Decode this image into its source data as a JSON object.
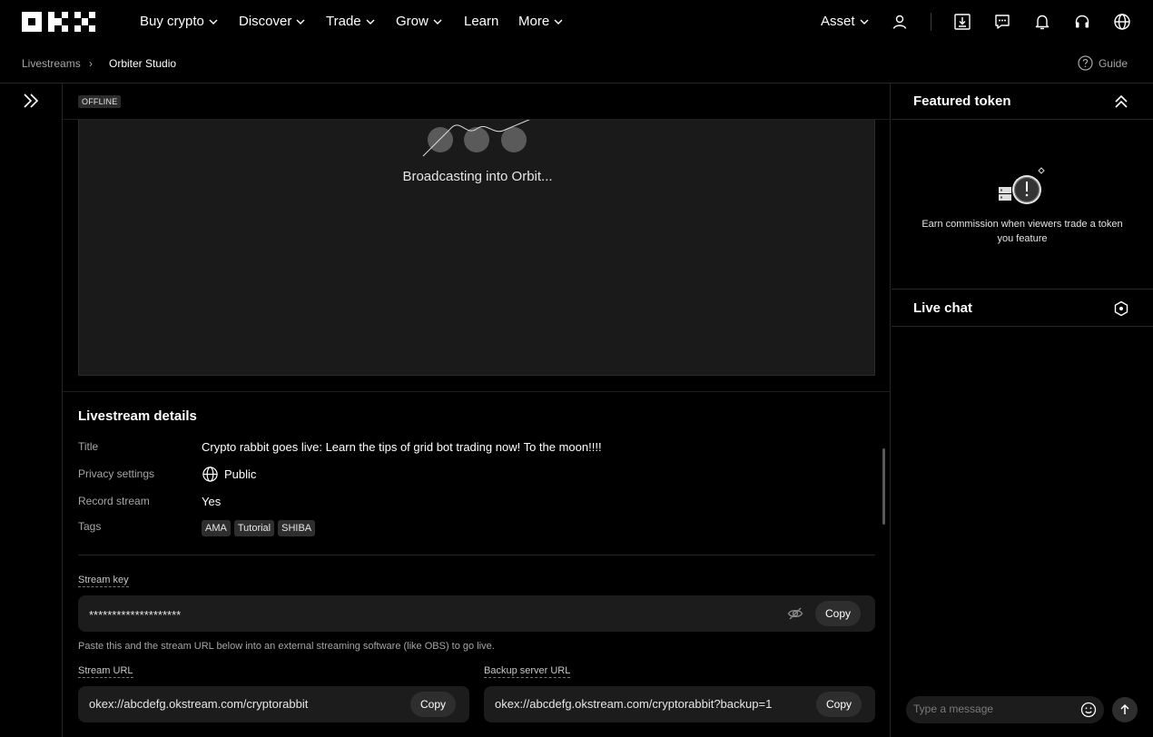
{
  "nav": {
    "logo": "OKX",
    "items": [
      {
        "label": "Buy crypto",
        "dropdown": true
      },
      {
        "label": "Discover",
        "dropdown": true
      },
      {
        "label": "Trade",
        "dropdown": true
      },
      {
        "label": "Grow",
        "dropdown": true
      },
      {
        "label": "Learn",
        "dropdown": false
      },
      {
        "label": "More",
        "dropdown": true
      }
    ],
    "asset_label": "Asset",
    "icons": [
      "user-icon",
      "download-icon",
      "message-icon",
      "bell-icon",
      "headset-icon",
      "globe-icon"
    ]
  },
  "breadcrumb": {
    "parent": "Livestreams",
    "separator": "›",
    "current": "Orbiter Studio"
  },
  "guide_label": "Guide",
  "stream": {
    "status": "OFFLINE",
    "broadcast_text": "Broadcasting into Orbit..."
  },
  "details": {
    "title": "Livestream details",
    "rows": {
      "title_label": "Title",
      "title_value": "Crypto rabbit goes live: Learn the tips of grid bot trading now! To the moon!!!!",
      "privacy_label": "Privacy settings",
      "privacy_value": "Public",
      "record_label": "Record stream",
      "record_value": "Yes",
      "tags_label": "Tags",
      "tags": [
        "AMA",
        "Tutorial",
        "SHIBA"
      ]
    }
  },
  "stream_key": {
    "label": "Stream key",
    "value": "********************",
    "copy_label": "Copy",
    "hint": "Paste this and the stream URL below into an external streaming software (like OBS) to go live."
  },
  "stream_url": {
    "label": "Stream URL",
    "value": "okex://abcdefg.okstream.com/cryptorabbit",
    "copy_label": "Copy"
  },
  "backup_url": {
    "label": "Backup server URL",
    "value": "okex://abcdefg.okstream.com/cryptorabbit?backup=1",
    "copy_label": "Copy"
  },
  "featured": {
    "title": "Featured token",
    "text": "Earn commission when viewers trade a token you feature"
  },
  "chat": {
    "title": "Live chat",
    "placeholder": "Type a message"
  }
}
